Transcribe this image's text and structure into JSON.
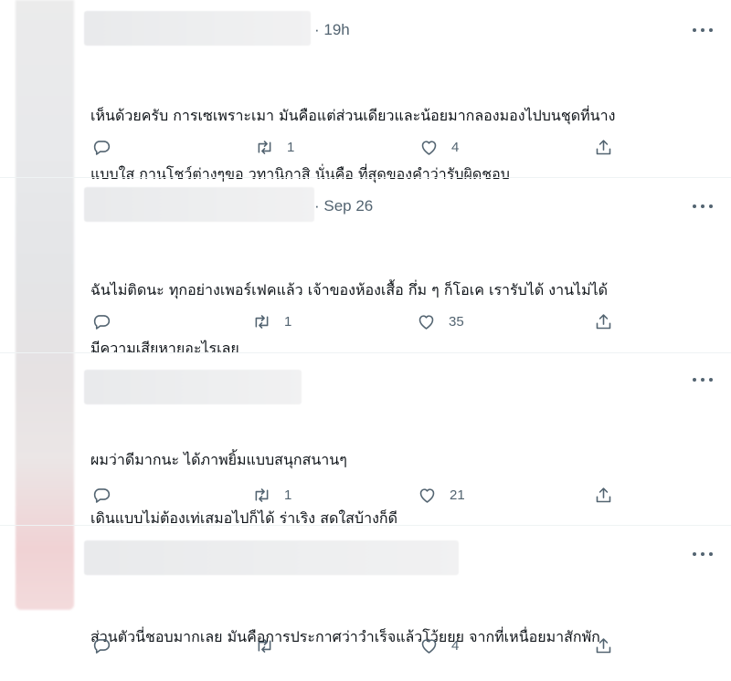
{
  "tweets": [
    {
      "time": "· 19h",
      "lines": [
        "เห็นด้วยครับ การเซเพราะเมา มันคือแต่ส่วนเดียวและน้อยมากลองมองไปบนชุดที่นาง",
        "แบบใส กานโชว์ต่างๆขอ วทานิกาสิ นั่นคือ ที่สุดของคำว่ารับผิดชอบ"
      ],
      "retweets": "1",
      "likes": "4"
    },
    {
      "time": "· Sep 26",
      "lines": [
        "ฉันไม่ติดนะ ทุกอย่างเพอร์เฟคแล้ว เจ้าของห้องเสื้อ กึ่ม ๆ ก็โอเค เรารับได้ งานไม่ได้",
        "มีความเสียหายอะไรเลย"
      ],
      "retweets": "1",
      "likes": "35"
    },
    {
      "time": "",
      "lines": [
        "ผมว่าดีมากนะ ได้ภาพยิ้มแบบสนุกสนานๆ",
        "เดินแบบไม่ต้องเท่เสมอไปก็ได้ ร่าเริง สดใสบ้างก็ดี"
      ],
      "retweets": "1",
      "likes": "21"
    },
    {
      "time": "",
      "lines": [
        "ส่วนตัวนี่ชอบมากเลย มันคือการประกาศว่าวำเร็จแล้วโว้ยยย จากที่เหนื่อยมาสักพัก"
      ],
      "retweets": "",
      "likes": "4"
    }
  ],
  "icons": {
    "reply": "reply-icon",
    "retweet": "retweet-icon",
    "like": "heart-icon",
    "share": "share-icon",
    "more": "more-icon"
  },
  "colors": {
    "secondary_text": "#536471",
    "primary_text": "#0f1419",
    "divider": "#eff3f4"
  }
}
